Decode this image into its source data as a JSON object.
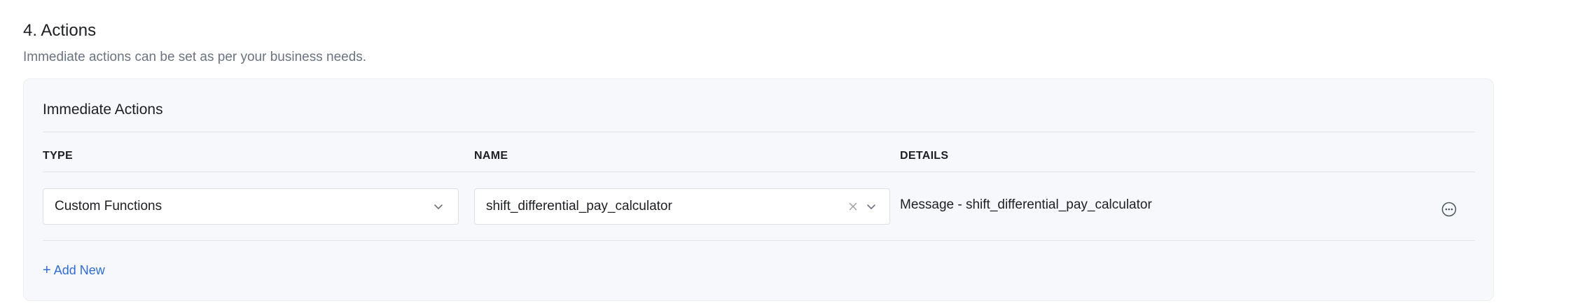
{
  "section": {
    "title": "4. Actions",
    "description": "Immediate actions can be set as per your business needs."
  },
  "card": {
    "title": "Immediate Actions",
    "columns": {
      "type": "TYPE",
      "name": "NAME",
      "details": "DETAILS"
    },
    "rows": [
      {
        "type": "Custom Functions",
        "name": "shift_differential_pay_calculator",
        "details": "Message - shift_differential_pay_calculator"
      }
    ],
    "add_new_label": "Add New",
    "add_new_icon": "+"
  },
  "colors": {
    "accent": "#2f6bd0",
    "card_bg": "#f7f8fb",
    "border": "#dcdfe5"
  }
}
